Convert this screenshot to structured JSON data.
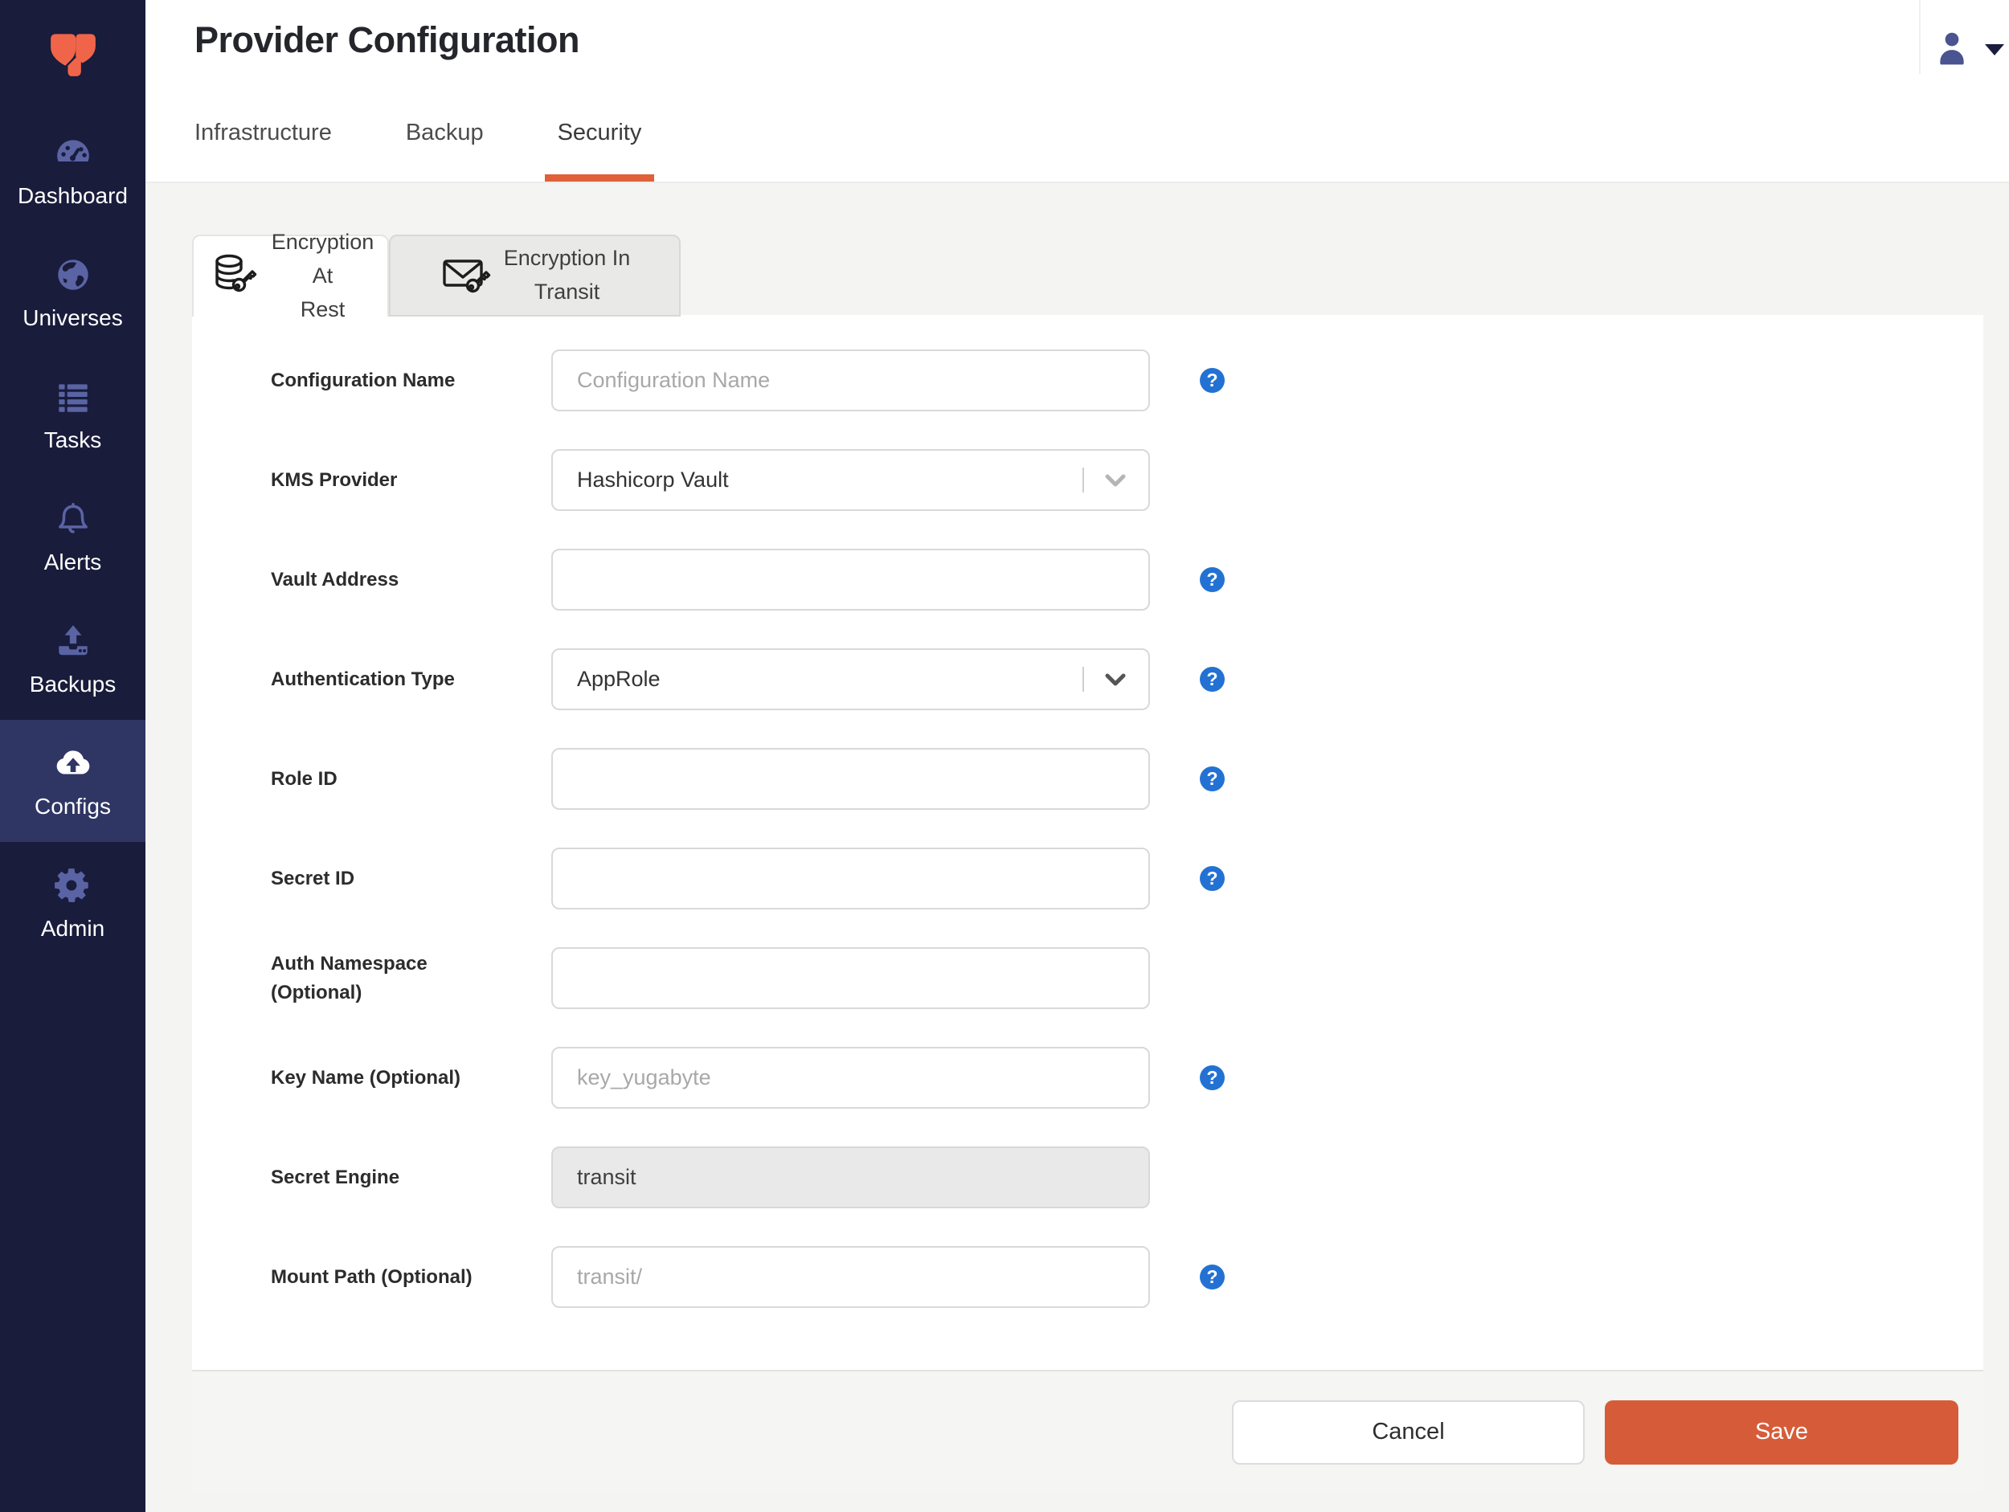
{
  "header": {
    "title": "Provider Configuration"
  },
  "tabs": [
    {
      "label": "Infrastructure",
      "active": false
    },
    {
      "label": "Backup",
      "active": false
    },
    {
      "label": "Security",
      "active": true
    }
  ],
  "sidebar": {
    "logo_icon": "yugabyte-logo",
    "items": [
      {
        "label": "Dashboard",
        "icon": "dashboard-gauge-icon",
        "active": false
      },
      {
        "label": "Universes",
        "icon": "universes-globe-icon",
        "active": false
      },
      {
        "label": "Tasks",
        "icon": "tasks-list-icon",
        "active": false
      },
      {
        "label": "Alerts",
        "icon": "alerts-bell-icon",
        "active": false
      },
      {
        "label": "Backups",
        "icon": "backups-upload-icon",
        "active": false
      },
      {
        "label": "Configs",
        "icon": "configs-cloud-upload-icon",
        "active": true
      },
      {
        "label": "Admin",
        "icon": "admin-gear-icon",
        "active": false
      }
    ]
  },
  "subtabs": [
    {
      "line1": "Encryption At",
      "line2": "Rest",
      "icon": "database-key-icon",
      "active": true
    },
    {
      "line1": "Encryption In",
      "line2": "Transit",
      "icon": "envelope-key-icon",
      "active": false
    }
  ],
  "form": {
    "fields": [
      {
        "label": "Configuration Name",
        "type": "text",
        "placeholder": "Configuration Name",
        "value": "",
        "help": true
      },
      {
        "label": "KMS Provider",
        "type": "select",
        "value": "Hashicorp Vault",
        "help": false
      },
      {
        "label": "Vault Address",
        "type": "text",
        "placeholder": "",
        "value": "",
        "help": true
      },
      {
        "label": "Authentication Type",
        "type": "select",
        "value": "AppRole",
        "help": true
      },
      {
        "label": "Role ID",
        "type": "text",
        "placeholder": "",
        "value": "",
        "help": true
      },
      {
        "label": "Secret ID",
        "type": "text",
        "placeholder": "",
        "value": "",
        "help": true
      },
      {
        "label": "Auth Namespace (Optional)",
        "type": "text",
        "placeholder": "",
        "value": "",
        "help": false
      },
      {
        "label": "Key Name (Optional)",
        "type": "text",
        "placeholder": "key_yugabyte",
        "value": "",
        "help": true
      },
      {
        "label": "Secret Engine",
        "type": "disabled",
        "value": "transit",
        "help": false
      },
      {
        "label": "Mount Path (Optional)",
        "type": "text",
        "placeholder": "transit/",
        "value": "",
        "help": true
      }
    ]
  },
  "footer": {
    "cancel_label": "Cancel",
    "save_label": "Save"
  },
  "colors": {
    "sidebar_bg": "#191c3b",
    "sidebar_active_bg": "#2f3664",
    "logo_orange": "#f0654a",
    "tab_underline": "#e06038",
    "help_blue": "#2372d3",
    "save_orange": "#d65c39"
  }
}
